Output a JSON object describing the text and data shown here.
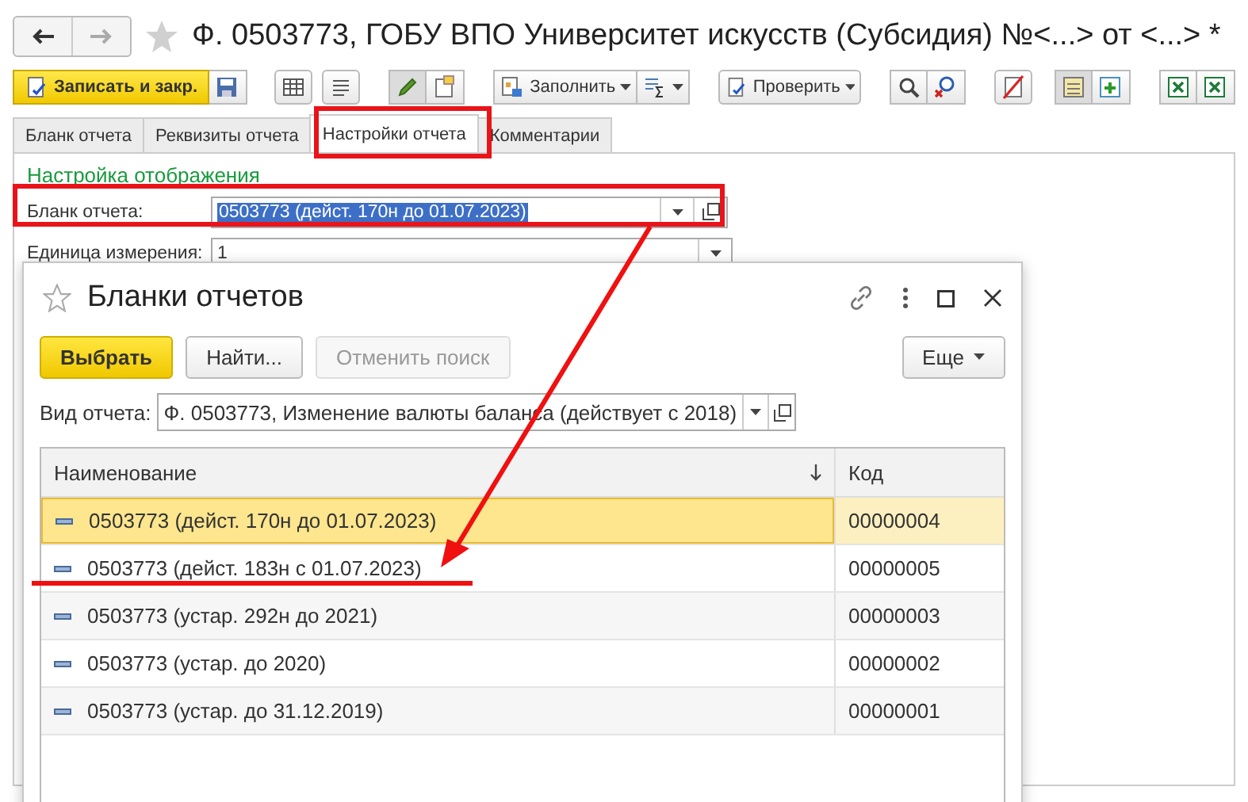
{
  "window": {
    "title": "Ф. 0503773, ГОБУ ВПО Университет искусств (Субсидия) №<...> от <...> *"
  },
  "toolbar": {
    "save_close": "Записать и закр.",
    "fill": "Заполнить",
    "check": "Проверить"
  },
  "tabs": [
    {
      "label": "Бланк отчета",
      "selected": false
    },
    {
      "label": "Реквизиты отчета",
      "selected": false
    },
    {
      "label": "Настройки отчета",
      "selected": true
    },
    {
      "label": "Комментарии",
      "selected": false
    }
  ],
  "settings": {
    "heading": "Настройка отображения",
    "fields": [
      {
        "label": "Бланк отчета:",
        "value": "0503773 (дейст. 170н до 01.07.2023)",
        "text_selected": true,
        "open_button": true
      },
      {
        "label": "Единица измерения:",
        "value": "1",
        "text_selected": false,
        "open_button": false
      }
    ]
  },
  "dialog": {
    "title": "Бланки отчетов",
    "buttons": [
      {
        "label": "Выбрать",
        "kind": "primary",
        "disabled": false
      },
      {
        "label": "Найти...",
        "kind": "normal",
        "disabled": false
      },
      {
        "label": "Отменить поиск",
        "kind": "normal",
        "disabled": true
      }
    ],
    "more_button": "Еще",
    "filter": {
      "label": "Вид отчета:",
      "value": "Ф. 0503773, Изменение валюты баланса (действует с 2018)"
    },
    "table": {
      "columns": [
        "Наименование",
        "Код"
      ],
      "rows": [
        {
          "name": "0503773 (дейст. 170н до 01.07.2023)",
          "code": "00000004",
          "selected": true
        },
        {
          "name": "0503773 (дейст. 183н с 01.07.2023)",
          "code": "00000005",
          "selected": false
        },
        {
          "name": "0503773 (устар. 292н до 2021)",
          "code": "00000003",
          "selected": false
        },
        {
          "name": "0503773 (устар. до 2020)",
          "code": "00000002",
          "selected": false
        },
        {
          "name": "0503773 (устар. до 31.12.2019)",
          "code": "00000001",
          "selected": false
        }
      ]
    }
  }
}
